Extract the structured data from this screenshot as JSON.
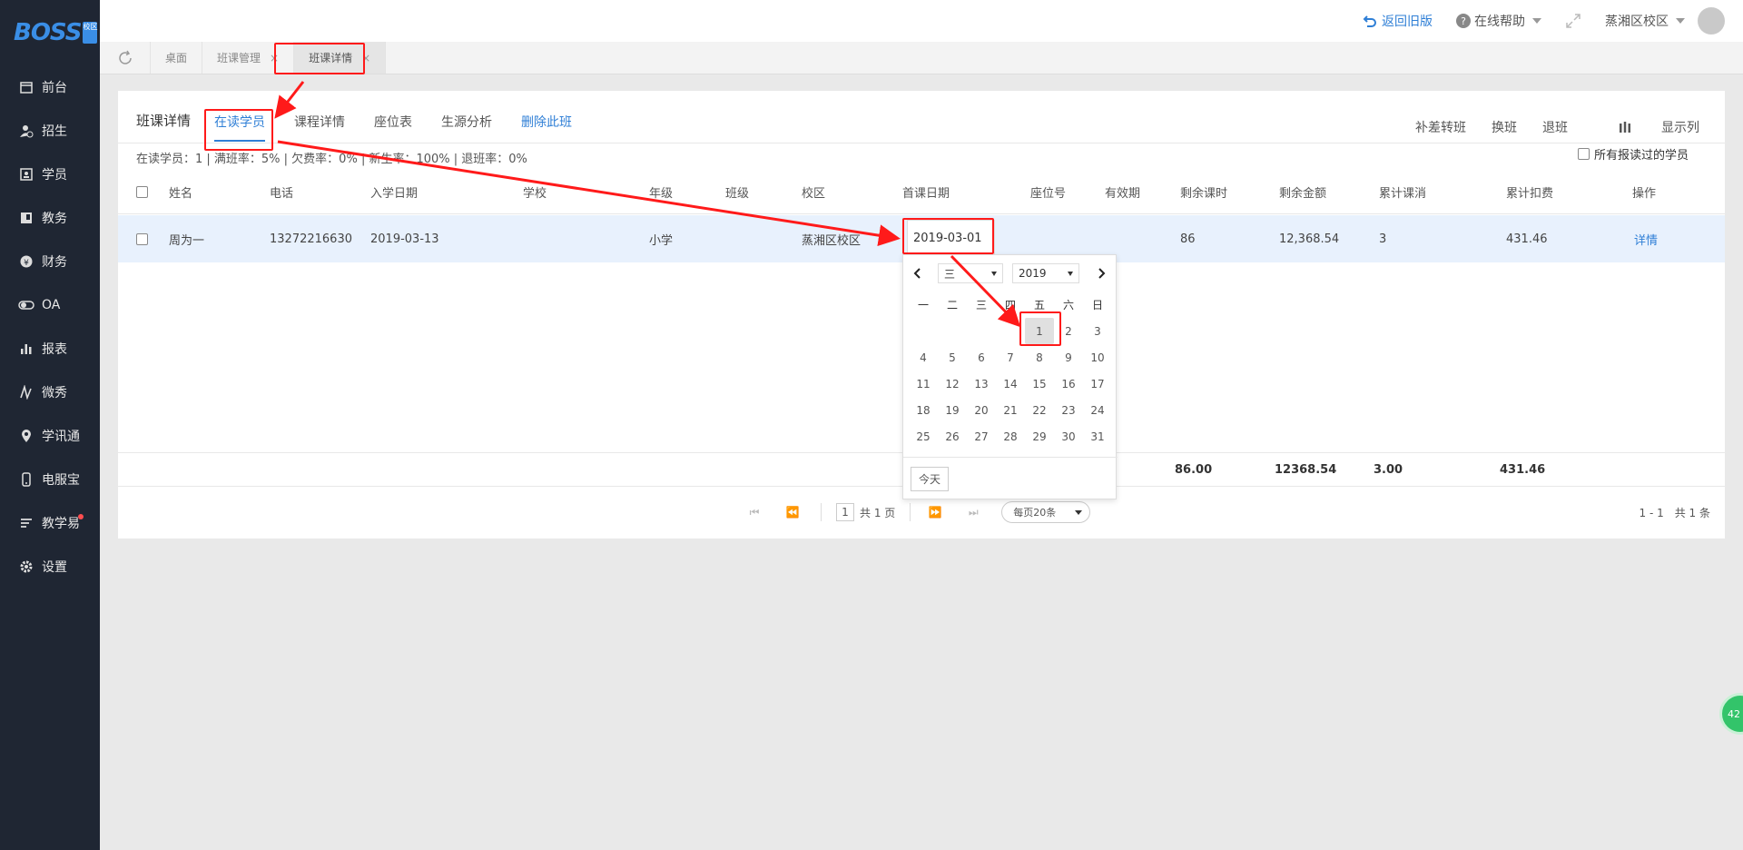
{
  "app": {
    "logo_text": "BOSS",
    "logo_badge": "校区"
  },
  "sidebar": {
    "items": [
      {
        "label": "前台",
        "icon": "calendar-icon"
      },
      {
        "label": "招生",
        "icon": "user-add-icon"
      },
      {
        "label": "学员",
        "icon": "student-card-icon"
      },
      {
        "label": "教务",
        "icon": "book-icon"
      },
      {
        "label": "财务",
        "icon": "yen-icon"
      },
      {
        "label": "OA",
        "icon": "toggle-icon"
      },
      {
        "label": "报表",
        "icon": "bar-chart-icon"
      },
      {
        "label": "微秀",
        "icon": "show-icon"
      },
      {
        "label": "学讯通",
        "icon": "location-icon"
      },
      {
        "label": "电服宝",
        "icon": "phone-icon"
      },
      {
        "label": "教学易",
        "icon": "teach-icon"
      },
      {
        "label": "设置",
        "icon": "gear-icon"
      }
    ]
  },
  "topbar": {
    "back_label": "返回旧版",
    "help_label": "在线帮助",
    "campus_label": "蒸湘区校区"
  },
  "tabs": [
    {
      "label": "桌面",
      "closable": false
    },
    {
      "label": "班课管理",
      "closable": true
    },
    {
      "label": "班课详情",
      "closable": true
    }
  ],
  "page": {
    "title": "班课详情",
    "sub_tabs": [
      "在读学员",
      "课程详情",
      "座位表",
      "生源分析",
      "删除此班"
    ],
    "actions": [
      "补差转班",
      "换班",
      "退班",
      "显示列"
    ],
    "stats": "在读学员：1 | 满班率：5% | 欠费率：0% | 新生率：100% | 退班率：0%",
    "all_students_label": "所有报读过的学员"
  },
  "table": {
    "headers": [
      "姓名",
      "电话",
      "入学日期",
      "学校",
      "年级",
      "班级",
      "校区",
      "首课日期",
      "座位号",
      "有效期",
      "剩余课时",
      "剩余金额",
      "累计课消",
      "累计扣费",
      "操作"
    ],
    "rows": [
      {
        "name": "周为一",
        "phone": "13272216630",
        "enroll_date": "2019-03-13",
        "school": "",
        "grade": "小学",
        "class": "",
        "campus": "蒸湘区校区",
        "first_lesson_date": "2019-03-01",
        "seat": "",
        "validity": "",
        "remaining_hours": "86",
        "remaining_amount": "12,368.54",
        "consumed": "3",
        "deducted": "431.46",
        "action": "详情"
      }
    ],
    "totals": {
      "remaining_hours": "86.00",
      "remaining_amount": "12368.54",
      "consumed": "3.00",
      "deducted": "431.46"
    }
  },
  "pagination": {
    "page": "1",
    "total_pages_label": "共 1 页",
    "page_size_label": "每页20条",
    "range_label": "1 - 1　共 1 条"
  },
  "datepicker": {
    "month": "三",
    "year": "2019",
    "weekdays": [
      "一",
      "二",
      "三",
      "四",
      "五",
      "六",
      "日"
    ],
    "weeks": [
      [
        "",
        "",
        "",
        "",
        "1",
        "2",
        "3"
      ],
      [
        "4",
        "5",
        "6",
        "7",
        "8",
        "9",
        "10"
      ],
      [
        "11",
        "12",
        "13",
        "14",
        "15",
        "16",
        "17"
      ],
      [
        "18",
        "19",
        "20",
        "21",
        "22",
        "23",
        "24"
      ],
      [
        "25",
        "26",
        "27",
        "28",
        "29",
        "30",
        "31"
      ]
    ],
    "selected": "1",
    "today_label": "今天"
  },
  "float_ball_text": "42",
  "colors": {
    "accent": "#2f7fd6",
    "sidebar": "#1f2633",
    "annotation": "#ff1a1a",
    "selected_row": "#e8f1fd"
  }
}
